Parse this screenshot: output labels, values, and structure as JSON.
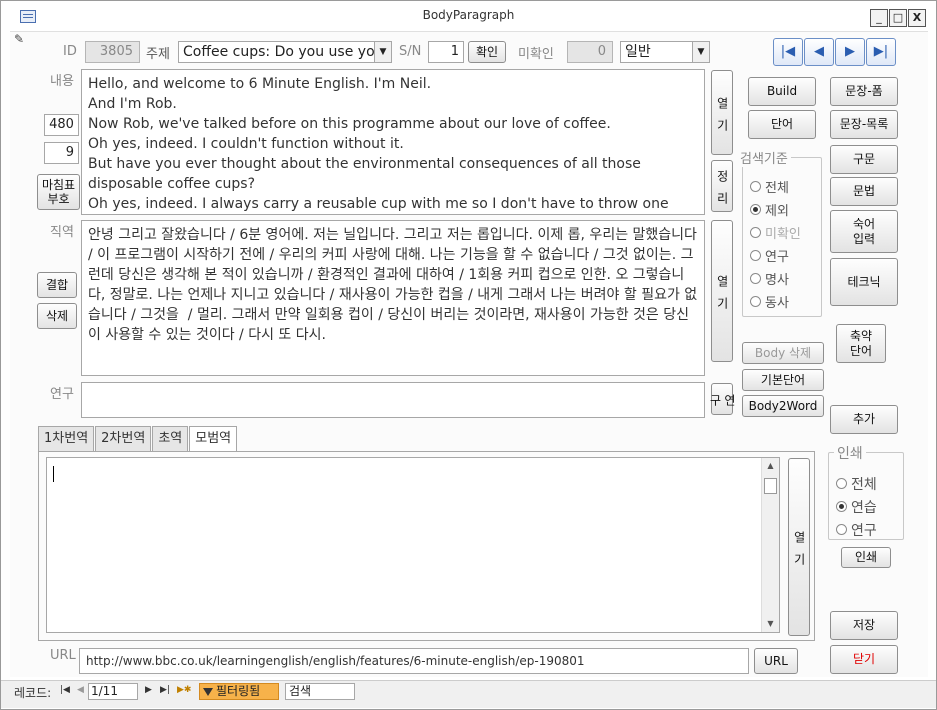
{
  "window": {
    "title": "BodyParagraph",
    "minimize": "_",
    "maximize": "□",
    "close": "X"
  },
  "header": {
    "id_label": "ID",
    "id_value": "3805",
    "topic_label": "주제",
    "topic_value": "Coffee cups: Do you use you",
    "sn_label": "S/N",
    "sn_value": "1",
    "confirm_button": "확인",
    "unconfirmed_label": "미확인",
    "unconfirmed_value": "0",
    "type_value": "일반"
  },
  "nav": {
    "first": "|◀",
    "prev": "◀",
    "next": "▶",
    "last": "▶|"
  },
  "content": {
    "label": "내용",
    "count1": "480",
    "count2": "9",
    "punct_button": "마침표\n부호",
    "text": "Hello, and welcome to 6 Minute English. I'm Neil.\nAnd I'm Rob.\nNow Rob, we've talked before on this programme about our love of coffee.\nOh yes, indeed. I couldn't function without it.\nBut have you ever thought about the environmental consequences of all those disposable coffee cups?\nOh yes, indeed. I always carry a reusable cup with me so I don't have to throw one",
    "open_button": "열\n기",
    "arrange_button": "정\n리"
  },
  "literal": {
    "label": "직역",
    "combine_button": "결합",
    "delete_button": "삭제",
    "text": "안녕 그리고 잘왔습니다 / 6분 영어에. 저는 닐입니다. 그리고 저는 롭입니다. 이제 롭, 우리는 말했습니다 / 이 프로그램이 시작하기 전에 / 우리의 커피 사랑에 대해. 나는 기능을 할 수 없습니다 / 그것 없이는. 그런데 당신은 생각해 본 적이 있습니까 / 환경적인 결과에 대하여 / 1회용 커피 컵으로 인한. 오 그렇습니다, 정말로. 나는 언제나 지니고 있습니다 / 재사용이 가능한 컵을 / 내게 그래서 나는 버려야 할 필요가 없습니다 / 그것을  / 멀리. 그래서 만약 일회용 컵이 / 당신이 버리는 것이라면, 재사용이 가능한 것은 당신이 사용할 수 있는 것이다 / 다시 또 다시.",
    "open_button": "열\n기"
  },
  "study": {
    "label": "연구",
    "value": "",
    "button": "연\n구"
  },
  "right_panel": {
    "build": "Build",
    "word": "단어",
    "sentence_form": "문장-폼",
    "sentence_list": "문장-목록",
    "phrase": "구문",
    "grammar": "문법",
    "idiom_input": "숙어\n입력",
    "technique": "테크닉",
    "search_group_title": "검색기준",
    "search_options": [
      {
        "label": "전체",
        "checked": false,
        "disabled": false
      },
      {
        "label": "제외",
        "checked": true,
        "disabled": false
      },
      {
        "label": "미확인",
        "checked": false,
        "disabled": true
      },
      {
        "label": "연구",
        "checked": false,
        "disabled": false
      },
      {
        "label": "명사",
        "checked": false,
        "disabled": false
      },
      {
        "label": "동사",
        "checked": false,
        "disabled": false
      }
    ],
    "body_delete": "Body 삭제",
    "basic_word": "기본단어",
    "body2word": "Body2Word",
    "abbrev_word": "축약\n단어",
    "add": "추가",
    "print_group_title": "인쇄",
    "print_options": [
      {
        "label": "전체",
        "checked": false
      },
      {
        "label": "연습",
        "checked": true
      },
      {
        "label": "연구",
        "checked": false
      }
    ],
    "print_button": "인쇄",
    "save": "저장",
    "close": "닫기",
    "close_color": "#e00000"
  },
  "tabs": [
    {
      "label": "1차번역",
      "active": false
    },
    {
      "label": "2차번역",
      "active": false
    },
    {
      "label": "초역",
      "active": false
    },
    {
      "label": "모범역",
      "active": true
    }
  ],
  "translation": {
    "value": "",
    "open_button": "열\n기"
  },
  "url": {
    "label": "URL",
    "value": "http://www.bbc.co.uk/learningenglish/english/features/6-minute-english/ep-190801",
    "button": "URL"
  },
  "statusbar": {
    "record_label": "레코드:",
    "first": "|◀",
    "prev": "◀",
    "position": "1/11",
    "next": "▶",
    "last": "▶|",
    "new": "▶✱",
    "filter_label": "필터링됨",
    "search_placeholder": "검색"
  }
}
